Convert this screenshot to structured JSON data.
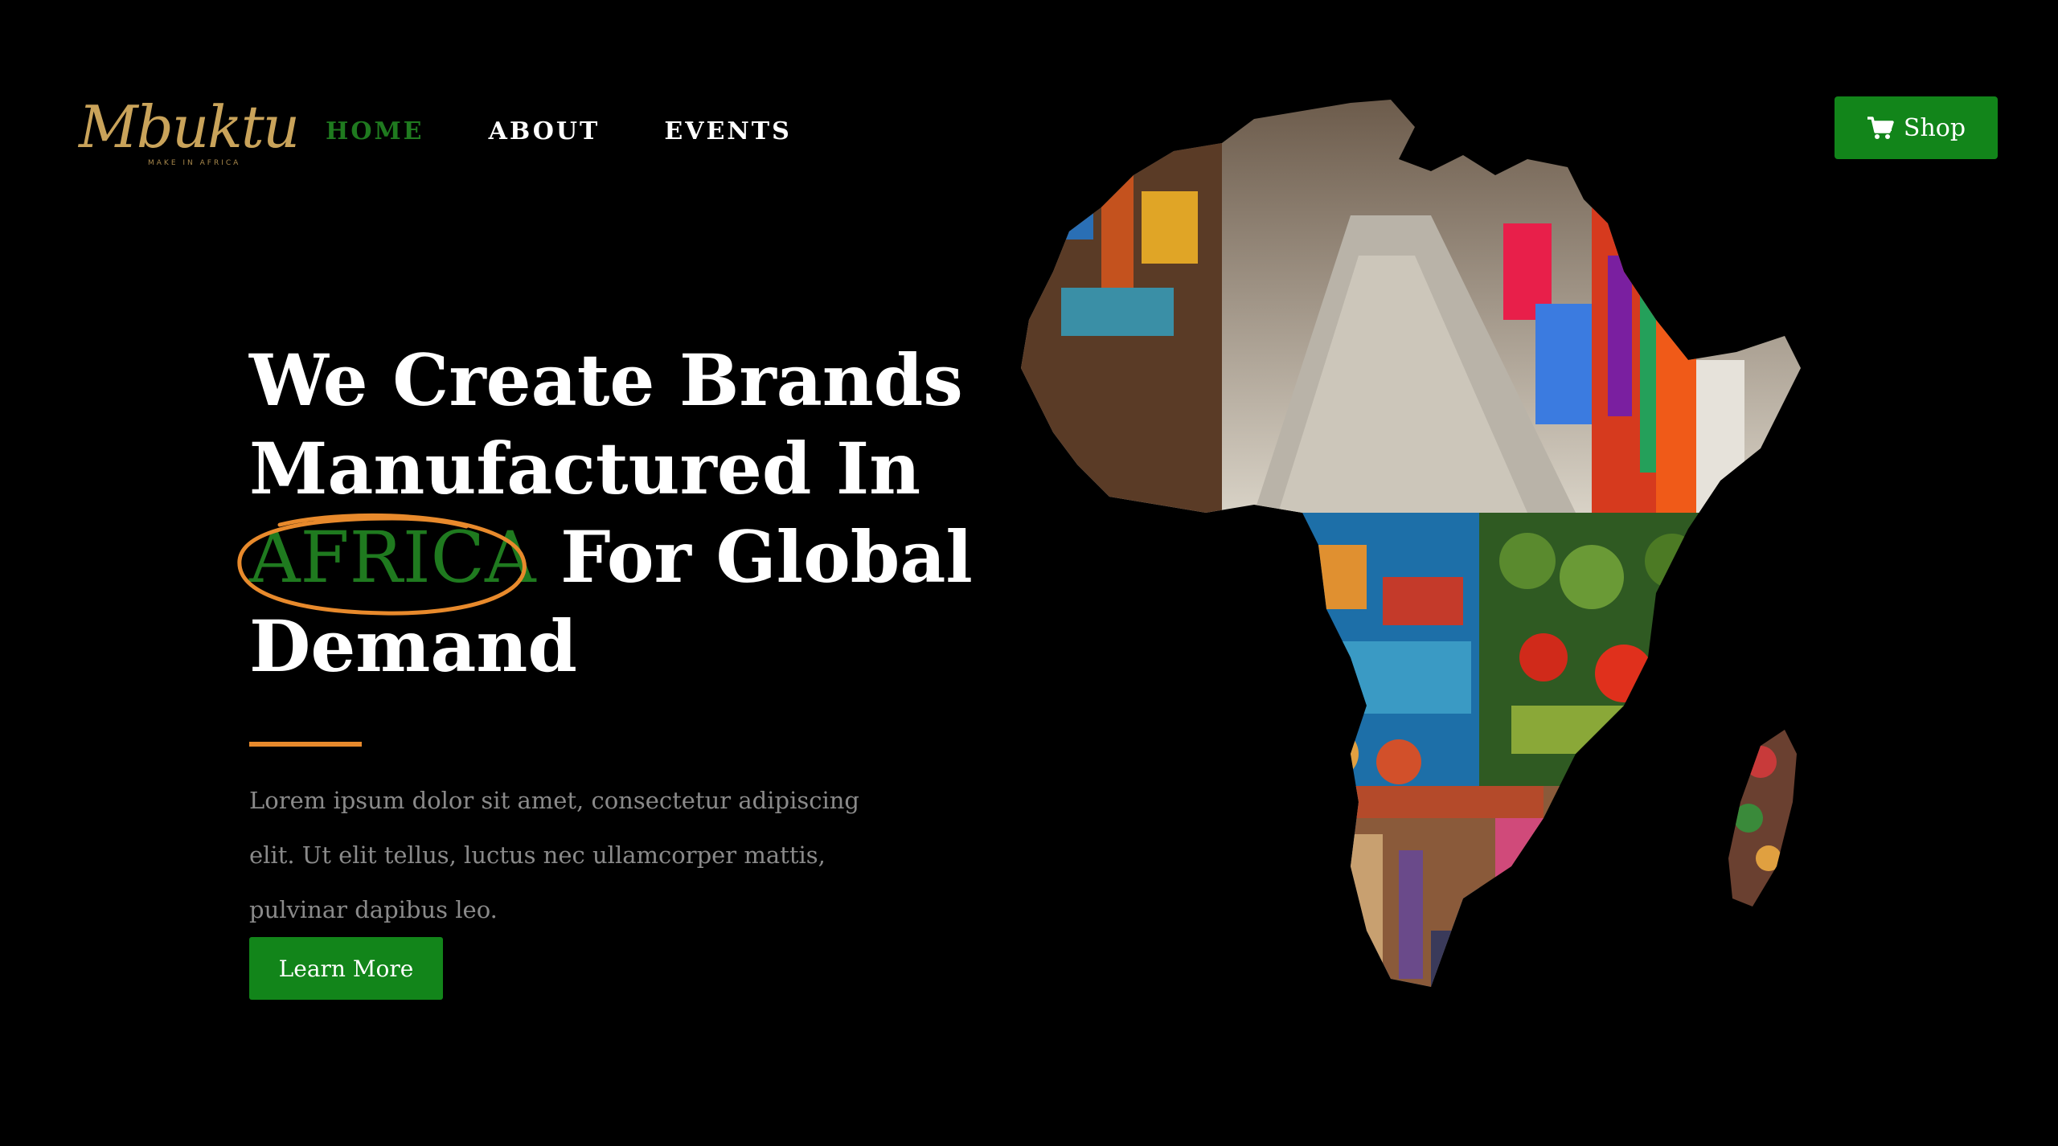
{
  "brand": {
    "name": "Mbuktu",
    "tagline": "MAKE IN AFRICA"
  },
  "nav": {
    "items": [
      {
        "label": "HOME",
        "active": true
      },
      {
        "label": "ABOUT",
        "active": false
      },
      {
        "label": "EVENTS",
        "active": false
      }
    ]
  },
  "header": {
    "shop_label": "Shop",
    "shop_icon": "cart-icon"
  },
  "hero": {
    "line1": "We Create Brands",
    "line2": "Manufactured In",
    "highlight": "AFRICA",
    "line3_rest": "For Global",
    "line4": "Demand",
    "body": "Lorem ipsum dolor sit amet, consectetur adipiscing elit. Ut elit tellus, luctus nec ullamcorper mattis, pulvinar dapibus leo.",
    "cta_label": "Learn More"
  },
  "colors": {
    "background": "#000000",
    "accent_green": "#12851a",
    "highlight_green": "#1f7a1f",
    "accent_orange": "#e88a2c",
    "logo_gold": "#c9a35a",
    "body_text": "#8a8a8a"
  }
}
